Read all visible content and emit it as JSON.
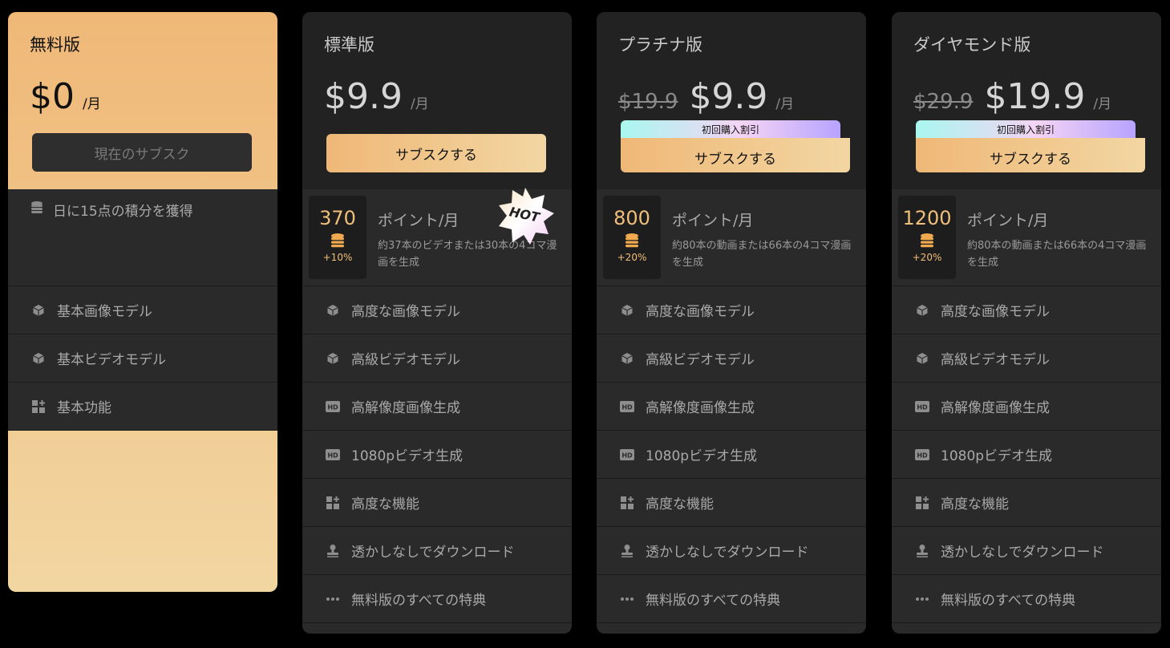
{
  "plans": [
    {
      "title": "無料版",
      "price": "$0",
      "per": "/月",
      "button": "現在のサブスク",
      "credit_line": "日に15点の積分を獲得",
      "features": [
        "基本画像モデル",
        "基本ビデオモデル",
        "基本功能"
      ]
    },
    {
      "title": "標準版",
      "price": "$9.9",
      "per": "/月",
      "button": "サブスクする",
      "credits": "370",
      "bonus": "+10%",
      "credit_title": "ポイント/月",
      "credit_desc": "約37本のビデオまたは30本の4コマ漫画を生成",
      "hot": "HOT",
      "features": [
        "高度な画像モデル",
        "高級ビデオモデル",
        "高解像度画像生成",
        "1080pビデオ生成",
        "高度な機能",
        "透かしなしでダウンロード",
        "無料版のすべての特典"
      ]
    },
    {
      "title": "プラチナ版",
      "old_price": "$19.9",
      "price": "$9.9",
      "per": "/月",
      "badge": "初回購入割引",
      "button": "サブスクする",
      "credits": "800",
      "bonus": "+20%",
      "credit_title": "ポイント/月",
      "credit_desc": "約80本の動画または66本の4コマ漫画を生成",
      "features": [
        "高度な画像モデル",
        "高級ビデオモデル",
        "高解像度画像生成",
        "1080pビデオ生成",
        "高度な機能",
        "透かしなしでダウンロード",
        "無料版のすべての特典"
      ]
    },
    {
      "title": "ダイヤモンド版",
      "old_price": "$29.9",
      "price": "$19.9",
      "per": "/月",
      "badge": "初回購入割引",
      "button": "サブスクする",
      "credits": "1200",
      "bonus": "+20%",
      "credit_title": "ポイント/月",
      "credit_desc": "約80本の動画または66本の4コマ漫画を生成",
      "features": [
        "高度な画像モデル",
        "高級ビデオモデル",
        "高解像度画像生成",
        "1080pビデオ生成",
        "高度な機能",
        "透かしなしでダウンロード",
        "無料版のすべての特典"
      ]
    }
  ],
  "feature_icons": [
    "cube-icon",
    "cube-icon",
    "hd-icon",
    "hd-icon",
    "grid-plus-icon",
    "stamp-icon",
    "more-dots-icon"
  ],
  "colors": {
    "accent": "#efb877",
    "accent_light": "#f2d6a2",
    "card_bg": "#2a2a2a",
    "page_bg": "#000000"
  }
}
